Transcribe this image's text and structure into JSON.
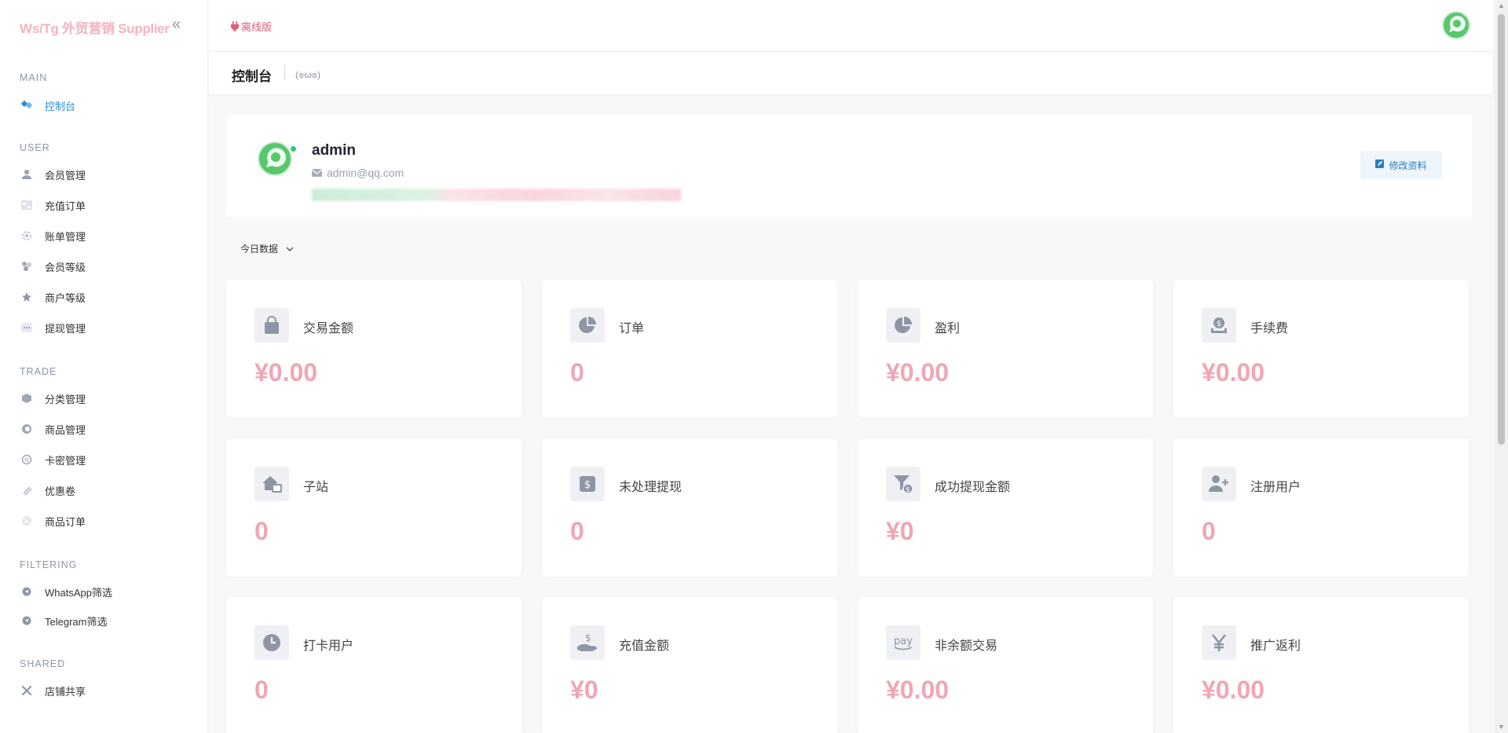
{
  "brand": "Ws/Tg 外贸营销 Supplier",
  "collapse_icon": "«",
  "sidebar": {
    "sections": [
      {
        "title": "MAIN",
        "items": [
          {
            "label": "控制台",
            "icon": "dashboard-icon",
            "active": true
          }
        ]
      },
      {
        "title": "USER",
        "items": [
          {
            "label": "会员管理",
            "icon": "user-icon"
          },
          {
            "label": "充值订单",
            "icon": "recharge-icon"
          },
          {
            "label": "账单管理",
            "icon": "bill-icon"
          },
          {
            "label": "会员等级",
            "icon": "level-icon"
          },
          {
            "label": "商户等级",
            "icon": "star-icon"
          },
          {
            "label": "提现管理",
            "icon": "withdraw-icon"
          }
        ]
      },
      {
        "title": "TRADE",
        "items": [
          {
            "label": "分类管理",
            "icon": "category-icon"
          },
          {
            "label": "商品管理",
            "icon": "product-icon"
          },
          {
            "label": "卡密管理",
            "icon": "card-icon"
          },
          {
            "label": "优惠卷",
            "icon": "coupon-icon"
          },
          {
            "label": "商品订单",
            "icon": "order-icon"
          }
        ]
      },
      {
        "title": "FILTERING",
        "items": [
          {
            "label": "WhatsApp筛选",
            "icon": "filter-icon"
          },
          {
            "label": "Telegram筛选",
            "icon": "filter-icon"
          }
        ]
      },
      {
        "title": "SHARED",
        "items": [
          {
            "label": "店铺共享",
            "icon": "share-icon"
          }
        ]
      }
    ]
  },
  "topbar": {
    "offline_label": "离线版"
  },
  "breadcrumb": {
    "title": "控制台",
    "face": "(๏ω๏)"
  },
  "profile": {
    "name": "admin",
    "email": "admin@qq.com",
    "edit_label": "修改资料"
  },
  "period_select": {
    "label": "今日数据"
  },
  "stats": [
    {
      "label": "交易金额",
      "value": "¥0.00",
      "icon": "bag-icon"
    },
    {
      "label": "订单",
      "value": "0",
      "icon": "pie-icon"
    },
    {
      "label": "盈利",
      "value": "¥0.00",
      "icon": "pie-icon"
    },
    {
      "label": "手续费",
      "value": "¥0.00",
      "icon": "money-icon"
    },
    {
      "label": "子站",
      "value": "0",
      "icon": "house-icon"
    },
    {
      "label": "未处理提现",
      "value": "0",
      "icon": "dollar-card-icon"
    },
    {
      "label": "成功提现金额",
      "value": "¥0",
      "icon": "funnel-dollar-icon"
    },
    {
      "label": "注册用户",
      "value": "0",
      "icon": "user-plus-icon"
    },
    {
      "label": "打卡用户",
      "value": "0",
      "icon": "clock-icon"
    },
    {
      "label": "充值金额",
      "value": "¥0",
      "icon": "hand-dollar-icon"
    },
    {
      "label": "非余额交易",
      "value": "¥0.00",
      "icon": "pay-icon"
    },
    {
      "label": "推广返利",
      "value": "¥0.00",
      "icon": "yen-icon"
    }
  ],
  "colors": {
    "accent": "#2a8fd6",
    "value_pink": "#f0a6b5",
    "brand_pink": "#f3b3c1",
    "offline_red": "#e05a78",
    "online_dot": "#2ecc71"
  }
}
